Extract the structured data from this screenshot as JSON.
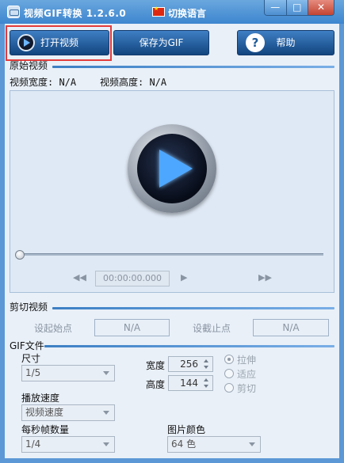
{
  "window": {
    "title": "视频GIF转换 1.2.6.0",
    "language_link": "切换语言",
    "controls": {
      "minimize": "—",
      "maximize": "□",
      "close": "✕"
    }
  },
  "toolbar": {
    "open_video": "打开视频",
    "save_gif": "保存为GIF",
    "help": "帮助",
    "help_glyph": "?"
  },
  "source": {
    "section_title": "原始视频",
    "width_label": "视频宽度: N/A",
    "height_label": "视频高度: N/A",
    "time": "00:00:00.000"
  },
  "clip": {
    "section_title": "剪切视频",
    "start_label": "设起始点",
    "start_value": "N/A",
    "end_label": "设截止点",
    "end_value": "N/A"
  },
  "gif": {
    "section_title": "GIF文件",
    "size_label": "尺寸",
    "size_value": "1/5",
    "width_label": "宽度",
    "width_value": "256",
    "height_label": "高度",
    "height_value": "144",
    "resize_options": [
      "拉伸",
      "适应",
      "剪切"
    ],
    "speed_label": "播放速度",
    "speed_value": "视频速度",
    "fps_label": "每秒帧数量",
    "fps_value": "1/4",
    "color_label": "图片颜色",
    "color_value": "64 色"
  },
  "icons": {
    "app": "app-icon",
    "flag": "china-flag-icon",
    "open": "play-circle-icon",
    "help": "question-circle-icon",
    "rewind": "rewind-icon",
    "play": "play-small-icon",
    "forward": "fast-forward-icon"
  },
  "colors": {
    "titlebar": "#4e92d8",
    "primary_button": "#1f5c9b",
    "focus_outline": "#e33b3b",
    "play_blue": "#4ea7ff",
    "background": "#e9f0f8"
  }
}
